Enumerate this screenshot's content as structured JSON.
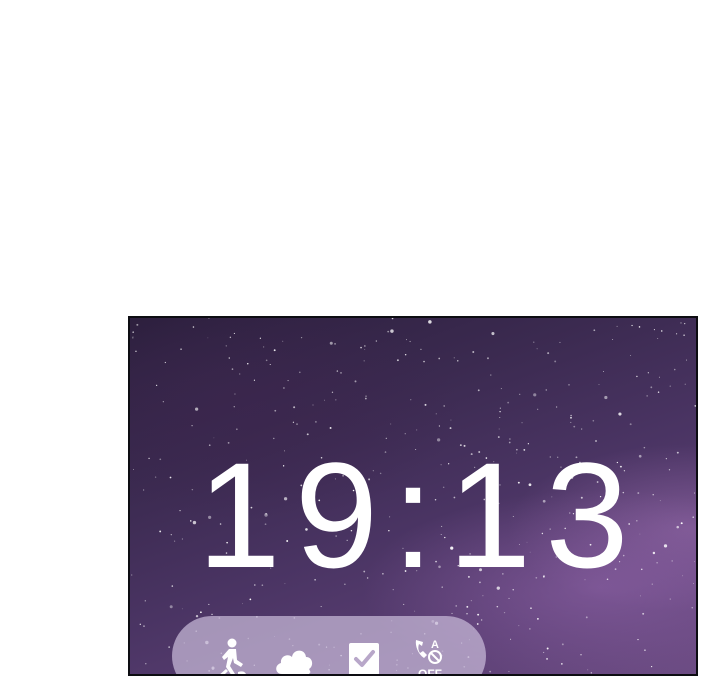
{
  "clock": {
    "time": "19:13"
  },
  "quick_actions": [
    {
      "icon": "walking-person-icon"
    },
    {
      "icon": "cloud-icon"
    },
    {
      "icon": "checkbox-icon"
    },
    {
      "icon": "call-auto-answer-off-icon",
      "badge_text": "OFF"
    }
  ],
  "colors": {
    "page_background": "#ffffff",
    "wallpaper_dark": "#2c1f3d",
    "wallpaper_light": "#6b4b82",
    "clock_text": "#ffffff",
    "quick_bar": "#c8bad8",
    "icon_fill": "#ffffff"
  }
}
